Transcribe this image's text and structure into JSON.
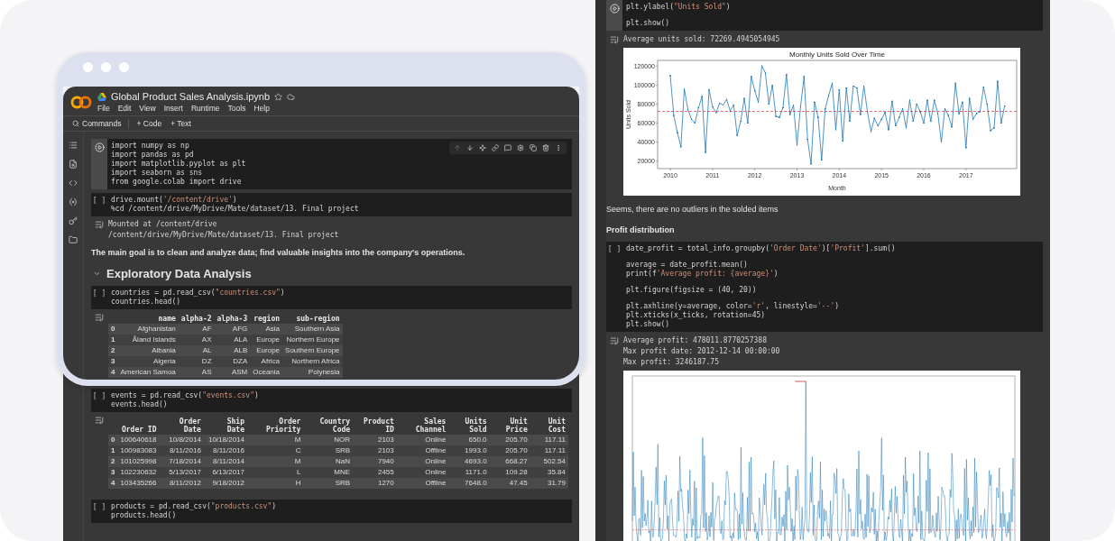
{
  "left_notebook": {
    "file_name": "Global Product Sales Analysis.ipynb",
    "menu": [
      "File",
      "Edit",
      "View",
      "Insert",
      "Runtime",
      "Tools",
      "Help"
    ],
    "toolbar": {
      "commands": "Commands",
      "add_code": "+ Code",
      "add_text": "+ Text"
    },
    "blocks": [
      {
        "kind": "code",
        "focused": true,
        "groups": [
          [
            "import numpy as np",
            "import pandas as pd",
            "import matplotlib.pyplot as plt",
            "import seaborn as sns",
            "from google.colab import drive"
          ]
        ]
      },
      {
        "kind": "code",
        "focused": false,
        "marker": "[ ]",
        "groups": [
          [
            "drive.mount('/content/drive')",
            "%cd /content/drive/MyDrive/Mate/dataset/13. Final project"
          ]
        ]
      },
      {
        "kind": "output",
        "lines": [
          "Mounted at /content/drive",
          "/content/drive/MyDrive/Mate/dataset/13. Final project"
        ]
      },
      {
        "kind": "text",
        "text": "The main goal is to clean and analyze data; find valuable insights into the company's operations."
      },
      {
        "kind": "heading",
        "text": "Exploratory Data Analysis",
        "expanded": true
      },
      {
        "kind": "code",
        "focused": false,
        "marker": "[ ]",
        "groups": [
          [
            "countries = pd.read_csv(\"countries.csv\")",
            "countries.head()"
          ]
        ]
      },
      {
        "kind": "output",
        "table": {
          "columns": [
            "name",
            "alpha-2",
            "alpha-3",
            "region",
            "sub-region"
          ],
          "rows": [
            {
              "index": "0",
              "cells": [
                "Afghanistan",
                "AF",
                "AFG",
                "Asia",
                "Southern Asia"
              ]
            },
            {
              "index": "1",
              "cells": [
                "Åland Islands",
                "AX",
                "ALA",
                "Europe",
                "Northern Europe"
              ]
            },
            {
              "index": "2",
              "cells": [
                "Albania",
                "AL",
                "ALB",
                "Europe",
                "Southern Europe"
              ]
            },
            {
              "index": "3",
              "cells": [
                "Algeria",
                "DZ",
                "DZA",
                "Africa",
                "Northern Africa"
              ]
            },
            {
              "index": "4",
              "cells": [
                "American Samoa",
                "AS",
                "ASM",
                "Oceania",
                "Polynesia"
              ]
            }
          ]
        }
      },
      {
        "kind": "code",
        "focused": false,
        "marker": "[ ]",
        "groups": [
          [
            "events = pd.read_csv(\"events.csv\")",
            "events.head()"
          ]
        ]
      },
      {
        "kind": "output",
        "table": {
          "columns": [
            "Order ID",
            "Order Date",
            "Ship Date",
            "Order Priority",
            "Country Code",
            "Product ID",
            "Sales Channel",
            "Units Sold",
            "Unit Price",
            "Unit Cost"
          ],
          "rows": [
            {
              "index": "0",
              "cells": [
                "100640618",
                "10/8/2014",
                "10/18/2014",
                "M",
                "NOR",
                "2103",
                "Online",
                "650.0",
                "205.70",
                "117.11"
              ]
            },
            {
              "index": "1",
              "cells": [
                "100983083",
                "8/11/2016",
                "8/11/2016",
                "C",
                "SRB",
                "2103",
                "Offline",
                "1993.0",
                "205.70",
                "117.11"
              ]
            },
            {
              "index": "2",
              "cells": [
                "101025998",
                "7/18/2014",
                "8/11/2014",
                "M",
                "NaN",
                "7940",
                "Online",
                "4693.0",
                "668.27",
                "502.54"
              ]
            },
            {
              "index": "3",
              "cells": [
                "102230632",
                "5/13/2017",
                "6/13/2017",
                "L",
                "MNE",
                "2455",
                "Online",
                "1171.0",
                "109.28",
                "35.84"
              ]
            },
            {
              "index": "4",
              "cells": [
                "103435266",
                "8/11/2012",
                "9/18/2012",
                "H",
                "SRB",
                "1270",
                "Offline",
                "7648.0",
                "47.45",
                "31.79"
              ]
            }
          ]
        }
      },
      {
        "kind": "code",
        "focused": false,
        "marker": "[ ]",
        "groups": [
          [
            "products = pd.read_csv(\"products.csv\")",
            "products.head()"
          ]
        ]
      }
    ]
  },
  "right_notebook": {
    "blocks": [
      {
        "kind": "code",
        "focused": true,
        "groups": [
          [
            "plt.ylabel(\"Units Sold\")"
          ],
          [
            "plt.show()"
          ]
        ]
      },
      {
        "kind": "output",
        "lines": [
          "Average units sold: 72269.4945054945"
        ],
        "chart_data": {
          "type": "line",
          "title": "Monthly Units Sold Over Time",
          "xlabel": "Month",
          "ylabel": "Units Sold",
          "xlim": [
            2009.7,
            2018.2
          ],
          "ylim": [
            12000,
            126000
          ],
          "xticks": [
            2010,
            2011,
            2012,
            2013,
            2014,
            2015,
            2016,
            2017
          ],
          "yticks": [
            20000,
            40000,
            60000,
            80000,
            100000,
            120000
          ],
          "x": [
            2010,
            2010.083,
            2010.167,
            2010.25,
            2010.333,
            2010.417,
            2010.5,
            2010.583,
            2010.667,
            2010.75,
            2010.833,
            2010.917,
            2011,
            2011.083,
            2011.167,
            2011.25,
            2011.333,
            2011.417,
            2011.5,
            2011.583,
            2011.667,
            2011.75,
            2011.833,
            2011.917,
            2012,
            2012.083,
            2012.167,
            2012.25,
            2012.333,
            2012.417,
            2012.5,
            2012.583,
            2012.667,
            2012.75,
            2012.833,
            2012.917,
            2013,
            2013.083,
            2013.167,
            2013.25,
            2013.333,
            2013.417,
            2013.5,
            2013.583,
            2013.667,
            2013.75,
            2013.833,
            2013.917,
            2014,
            2014.083,
            2014.167,
            2014.25,
            2014.333,
            2014.417,
            2014.5,
            2014.583,
            2014.667,
            2014.75,
            2014.833,
            2014.917,
            2015,
            2015.083,
            2015.167,
            2015.25,
            2015.333,
            2015.417,
            2015.5,
            2015.583,
            2015.667,
            2015.75,
            2015.833,
            2015.917,
            2016,
            2016.083,
            2016.167,
            2016.25,
            2016.333,
            2016.417,
            2016.5,
            2016.583,
            2016.667,
            2016.75,
            2016.833,
            2016.917,
            2017,
            2017.083,
            2017.167,
            2017.25,
            2017.333,
            2017.417,
            2017.5,
            2017.583,
            2017.667,
            2017.75,
            2017.833,
            2017.917
          ],
          "series": [
            {
              "color": "#1f77b4",
              "values": [
                110000,
                68000,
                50000,
                35000,
                96000,
                74000,
                64000,
                60000,
                76000,
                88000,
                29000,
                95000,
                77000,
                71000,
                81000,
                79000,
                85000,
                73000,
                79000,
                47000,
                62000,
                86000,
                60000,
                109000,
                94000,
                82000,
                120000,
                113000,
                80000,
                100000,
                67000,
                66000,
                76000,
                111000,
                69000,
                79000,
                37000,
                77000,
                109000,
                43000,
                17000,
                82000,
                66000,
                21000,
                75000,
                89000,
                102000,
                53000,
                95000,
                41000,
                97000,
                62000,
                99000,
                97000,
                69000,
                99000,
                72000,
                51000,
                65000,
                57000,
                64000,
                71000,
                53000,
                83000,
                57000,
                66000,
                75000,
                55000,
                84000,
                62000,
                80000,
                72000,
                60000,
                84000,
                62000,
                84000,
                70000,
                40000,
                75000,
                68000,
                56000,
                102000,
                70000,
                82000,
                34000,
                86000,
                64000,
                70000,
                72000,
                98000,
                80000,
                52000,
                55000,
                104000,
                60000,
                78000
              ]
            }
          ],
          "ref_lines": [
            {
              "axis": "y",
              "value": 72269.4945,
              "color": "#d62728"
            }
          ]
        }
      },
      {
        "kind": "text",
        "text": "Seems, there are no outliers in the solded items"
      },
      {
        "kind": "subheading",
        "text": "Profit distribution"
      },
      {
        "kind": "code",
        "focused": false,
        "marker": "[ ]",
        "groups": [
          [
            "date_profit = total_info.groupby('Order Date')['Profit'].sum()"
          ],
          [
            "average = date_profit.mean()",
            "print(f'Average profit: {average}')"
          ],
          [
            "plt.figure(figsize = (40, 20))"
          ],
          [
            "plt.axhline(y=average, color='r', linestyle='--')",
            "plt.xticks(x_ticks, rotation=45)",
            "plt.show()"
          ]
        ]
      },
      {
        "kind": "output",
        "lines": [
          "Average profit: 478011.8770257388",
          "Max profit date: 2012-12-14 00:00:00",
          "Max profit: 3246187.75"
        ],
        "has_figure": true
      }
    ]
  }
}
